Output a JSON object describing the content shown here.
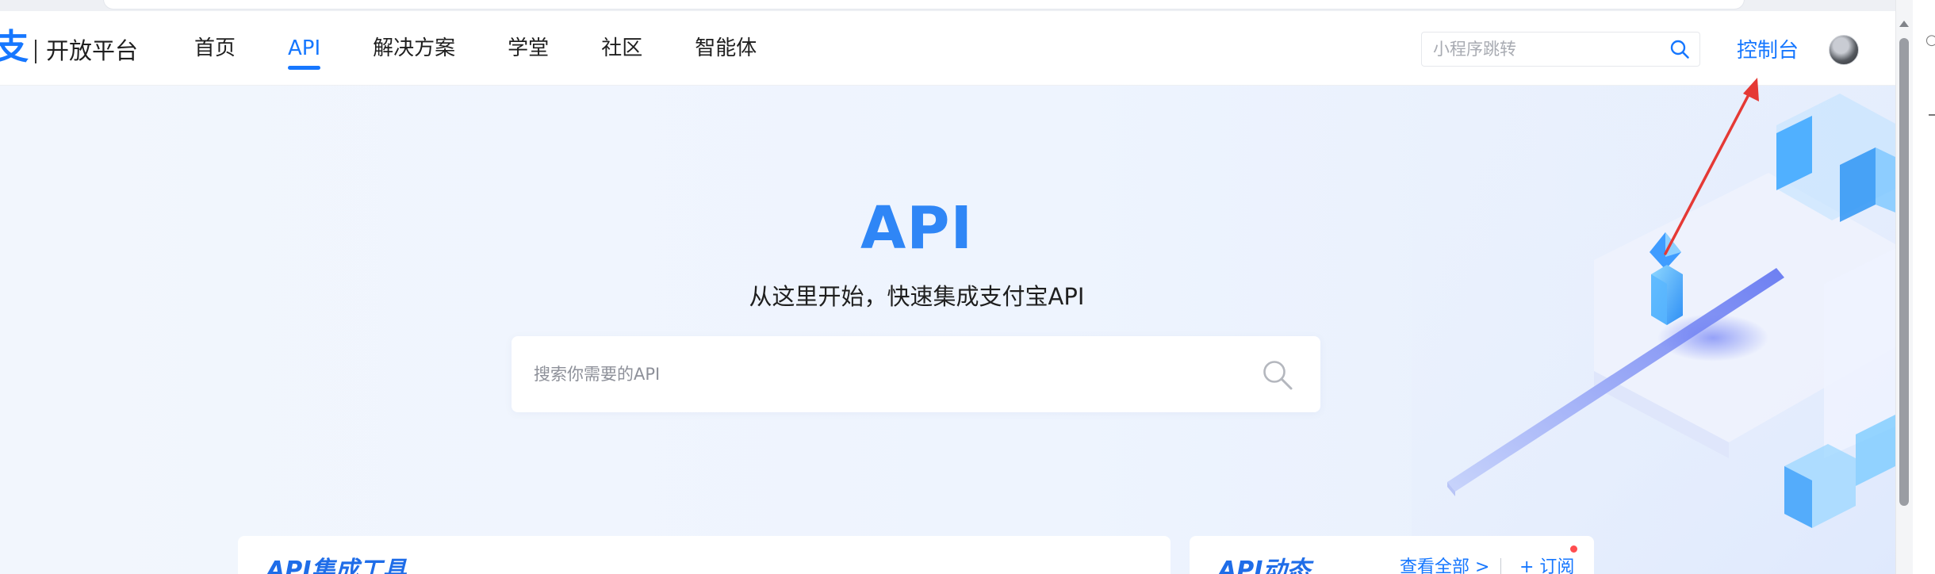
{
  "header": {
    "logo_mark": "支",
    "logo_text": "开放平台",
    "nav": [
      {
        "label": "首页",
        "active": false
      },
      {
        "label": "API",
        "active": true
      },
      {
        "label": "解决方案",
        "active": false
      },
      {
        "label": "学堂",
        "active": false
      },
      {
        "label": "社区",
        "active": false
      },
      {
        "label": "智能体",
        "active": false
      }
    ],
    "mini_search": {
      "placeholder": "小程序跳转",
      "icon": "search-icon"
    },
    "console_label": "控制台",
    "avatar": "user-avatar"
  },
  "hero": {
    "title": "API",
    "subtitle": "从这里开始，快速集成支付宝API",
    "search": {
      "placeholder": "搜索你需要的API",
      "icon": "search-icon"
    }
  },
  "cards": {
    "tools": {
      "title": "API集成工具"
    },
    "news": {
      "title": "API动态",
      "view_all": "查看全部 >",
      "subscribe": "+ 订阅"
    }
  },
  "colors": {
    "brand": "#1677ff",
    "hero_title": "#2f86f6",
    "annotation": "#e53935",
    "notification_dot": "#ff4d4f"
  }
}
